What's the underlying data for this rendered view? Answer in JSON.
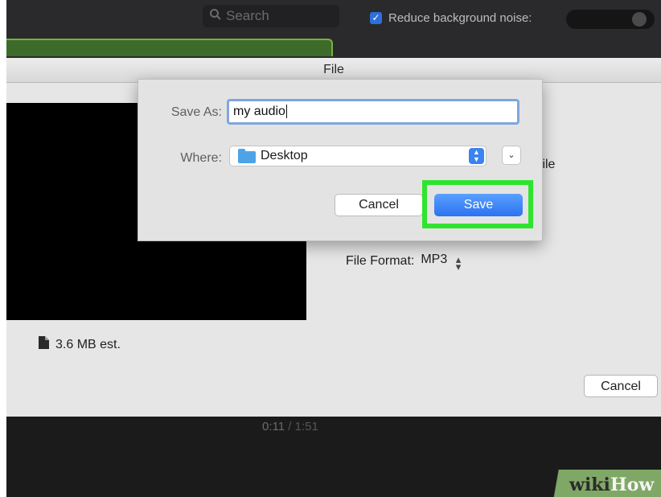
{
  "toolbar": {
    "search_placeholder": "Search",
    "reduce_noise_label": "Reduce background noise:",
    "reduce_noise_checked": true
  },
  "share_sheet": {
    "title": "File",
    "partial_text_file": "file",
    "file_format_label": "File Format:",
    "file_format_value": "MP3",
    "size_estimate": "3.6 MB est.",
    "cancel_label": "Cancel"
  },
  "save_dialog": {
    "save_as_label": "Save As:",
    "save_as_value": "my audio",
    "where_label": "Where:",
    "where_value": "Desktop",
    "cancel_label": "Cancel",
    "save_label": "Save",
    "highlight_color": "#2fe42f",
    "accent_color": "#3b82f2"
  },
  "playback": {
    "current_time": "0:11",
    "separator": "/",
    "total_time": "1:51"
  },
  "watermark": {
    "part1": "wiki",
    "part2": "How"
  }
}
